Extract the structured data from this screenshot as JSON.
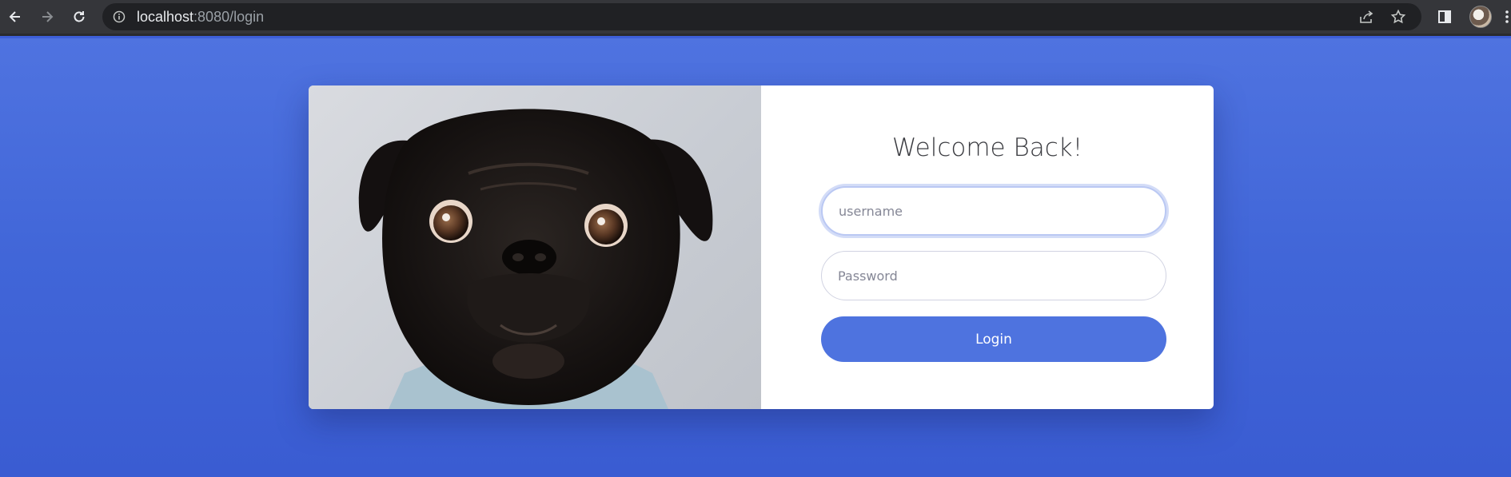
{
  "browser": {
    "url_host": "localhost",
    "url_rest": ":8080/login",
    "icons": [
      "back-icon",
      "forward-icon",
      "reload-icon",
      "info-icon",
      "share-icon",
      "star-icon",
      "sidebar-icon",
      "avatar",
      "menu-icon"
    ]
  },
  "login": {
    "title": "Welcome Back!",
    "username_placeholder": "username",
    "password_placeholder": "Password",
    "button_label": "Login"
  },
  "colors": {
    "background": "#4166d8",
    "button": "#4e73df",
    "card": "#ffffff"
  },
  "image": {
    "subject": "pug-dog-photo"
  }
}
